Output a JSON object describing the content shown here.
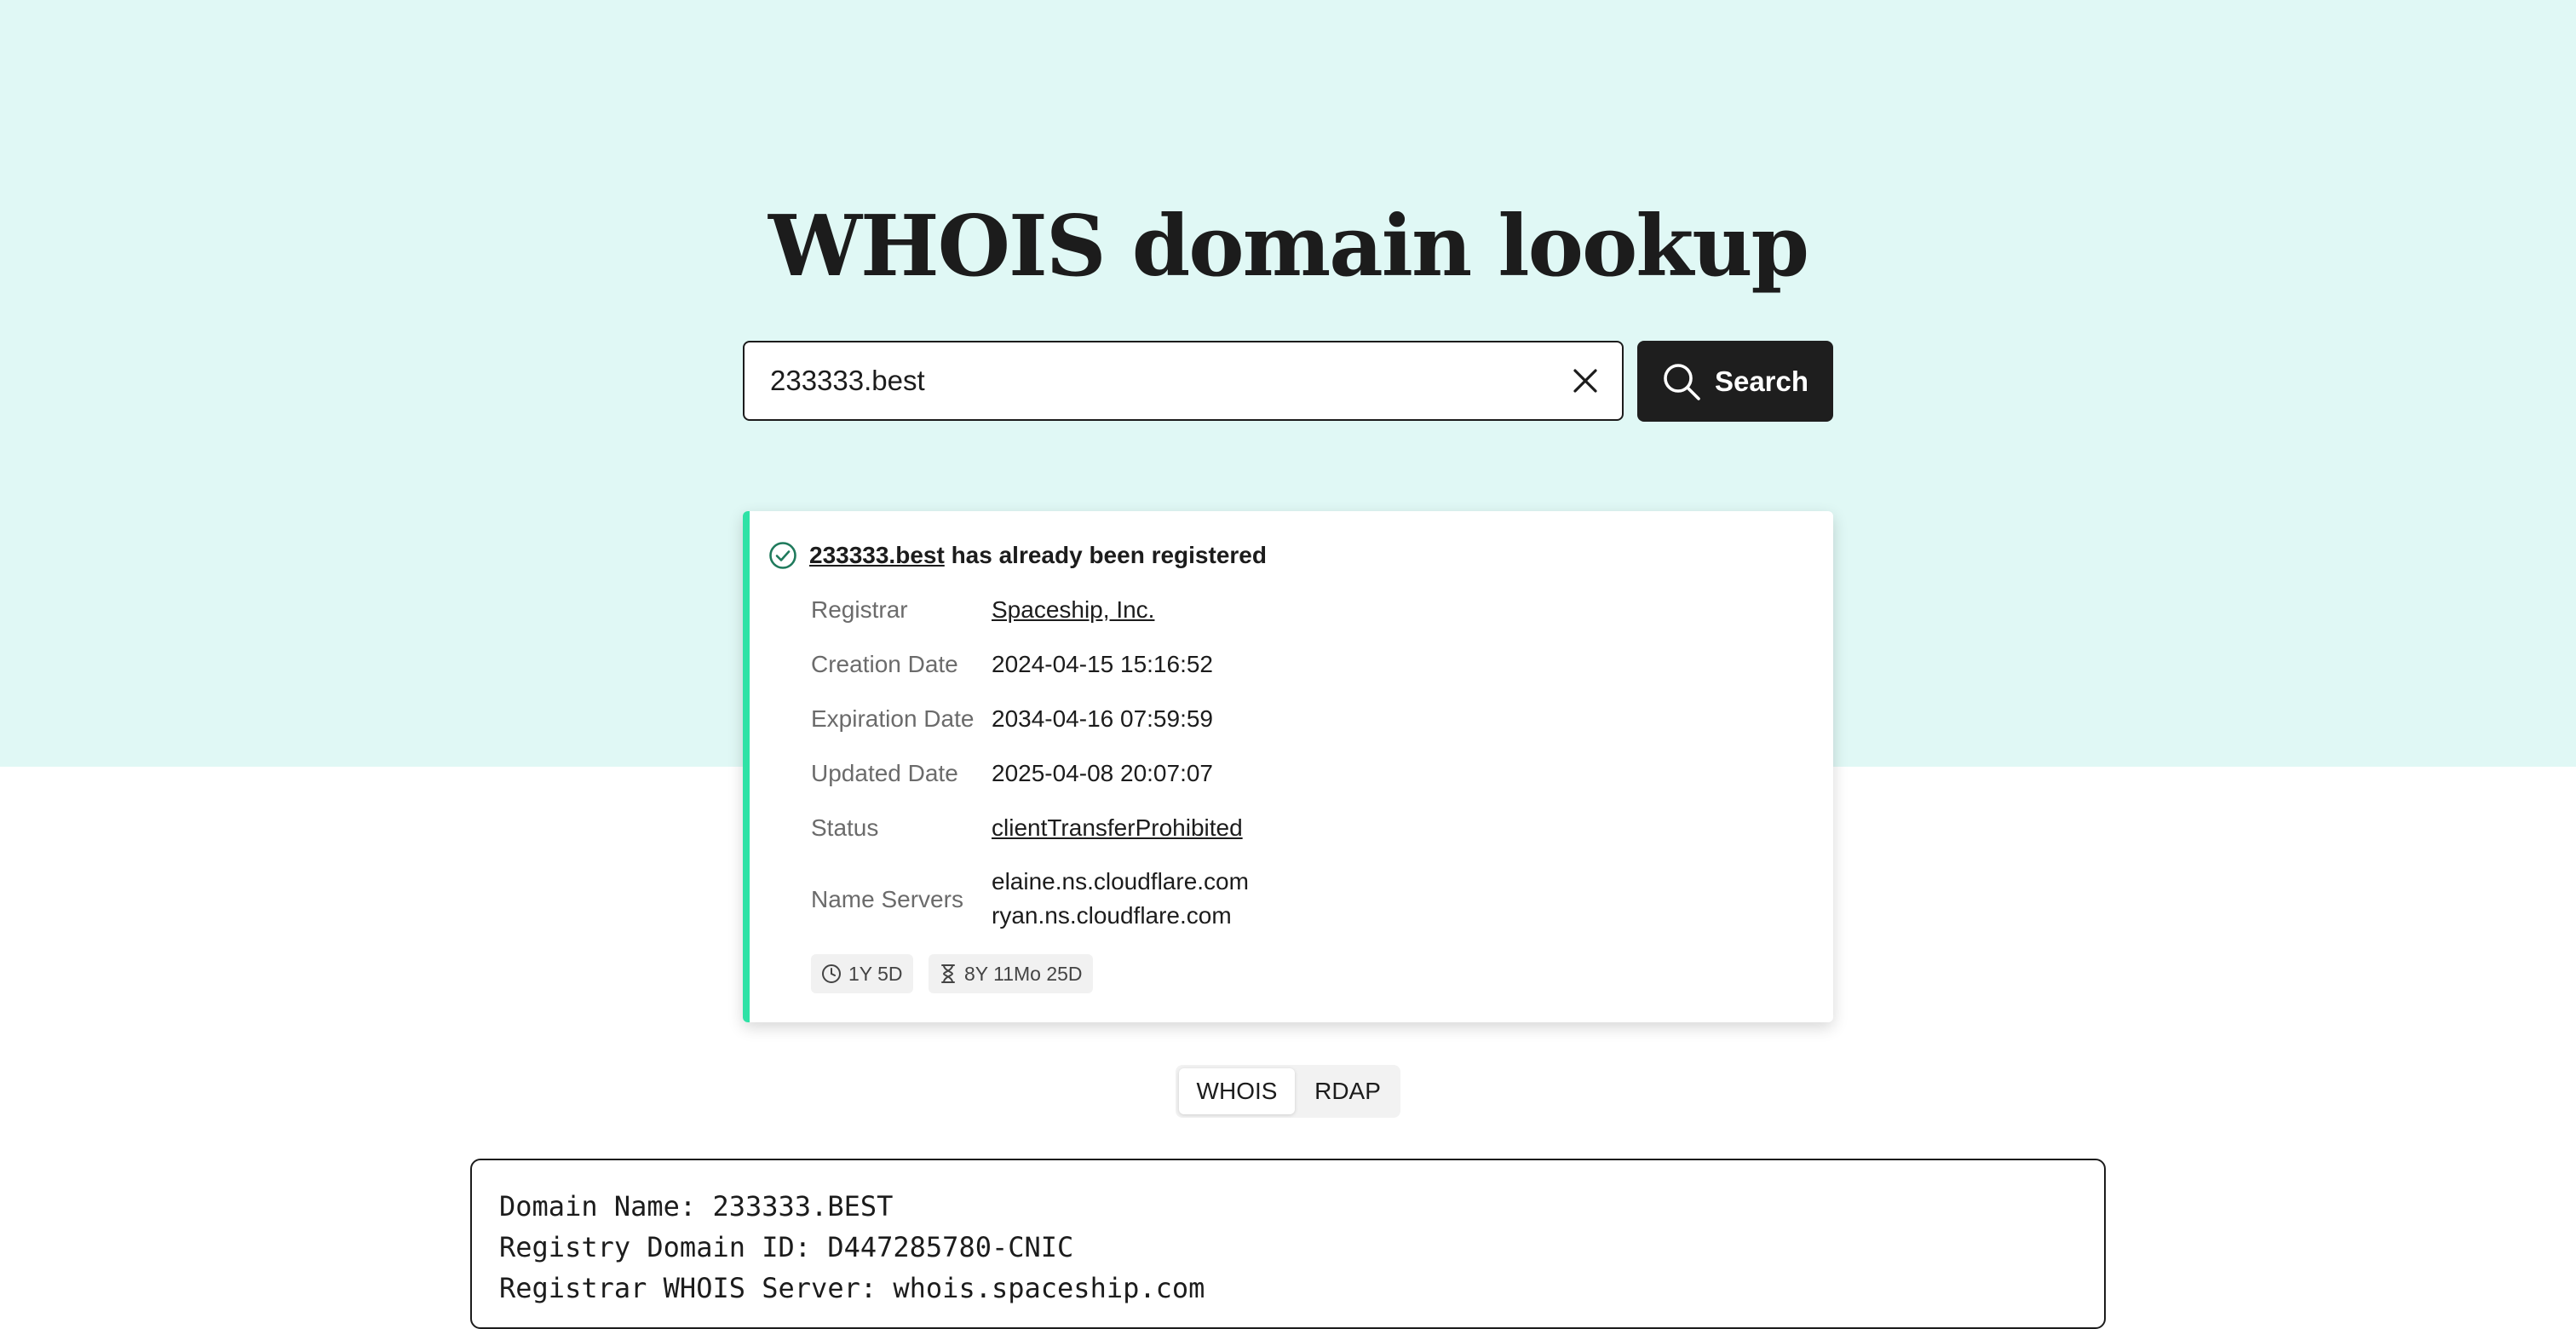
{
  "page": {
    "title": "WHOIS domain lookup"
  },
  "search": {
    "value": "233333.best",
    "button_label": "Search"
  },
  "result": {
    "domain": "233333.best",
    "status_message": "has already been registered",
    "details": [
      {
        "label": "Registrar",
        "value": "Spaceship, Inc."
      },
      {
        "label": "Creation Date",
        "value": "2024-04-15 15:16:52"
      },
      {
        "label": "Expiration Date",
        "value": "2034-04-16 07:59:59"
      },
      {
        "label": "Updated Date",
        "value": "2025-04-08 20:07:07"
      },
      {
        "label": "Status",
        "value": "clientTransferProhibited"
      },
      {
        "label": "Name Servers",
        "values": [
          "elaine.ns.cloudflare.com",
          "ryan.ns.cloudflare.com"
        ]
      }
    ],
    "badges": {
      "age": "1Y 5D",
      "remaining": "8Y 11Mo 25D"
    }
  },
  "tabs": [
    {
      "label": "WHOIS",
      "active": true
    },
    {
      "label": "RDAP",
      "active": false
    }
  ],
  "raw_whois": [
    "Domain Name: 233333.BEST",
    "Registry Domain ID: D447285780-CNIC",
    "Registrar WHOIS Server: whois.spaceship.com"
  ],
  "colors": {
    "hero_background": "#e0f8f5",
    "accent": "#2fe2a6",
    "button": "#1e1e1e",
    "success_icon": "#1f7a5c"
  }
}
